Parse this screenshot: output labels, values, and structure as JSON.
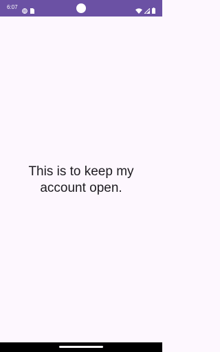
{
  "status_bar": {
    "time": "6:07",
    "background_color": "#6b51a4",
    "left_icons": [
      "vpn-globe-icon",
      "sim-card-icon"
    ],
    "right_icons": [
      "wifi-icon",
      "cellular-signal-icon",
      "battery-icon"
    ]
  },
  "main": {
    "message": "This is to keep my account open.",
    "background_color": "#fdf7fe",
    "text_color": "#1d1b20"
  },
  "nav_bar": {
    "background_color": "#000000"
  }
}
